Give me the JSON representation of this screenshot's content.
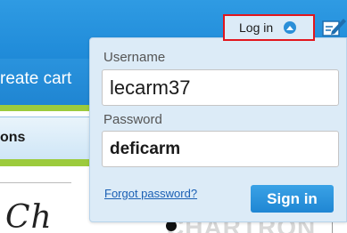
{
  "header": {
    "login_toggle_label": "Log in",
    "create_cart_text": "reate cart",
    "options_text": "ons"
  },
  "login_panel": {
    "username_label": "Username",
    "username_value": "lecarm37",
    "password_label": "Password",
    "password_value": "deficarm",
    "forgot_password_link": "Forgot password?",
    "sign_in_button": "Sign in"
  },
  "background": {
    "script_text": "Ch",
    "brand_text": "CHARTRON"
  },
  "colors": {
    "header_blue": "#1f8ad8",
    "panel_bg": "#dcebf7",
    "accent_green": "#9ccb3c",
    "highlight_red": "#e2161d",
    "button_blue": "#2b8fd8"
  },
  "icons": [
    "chevron-up-icon",
    "edit-icon"
  ]
}
